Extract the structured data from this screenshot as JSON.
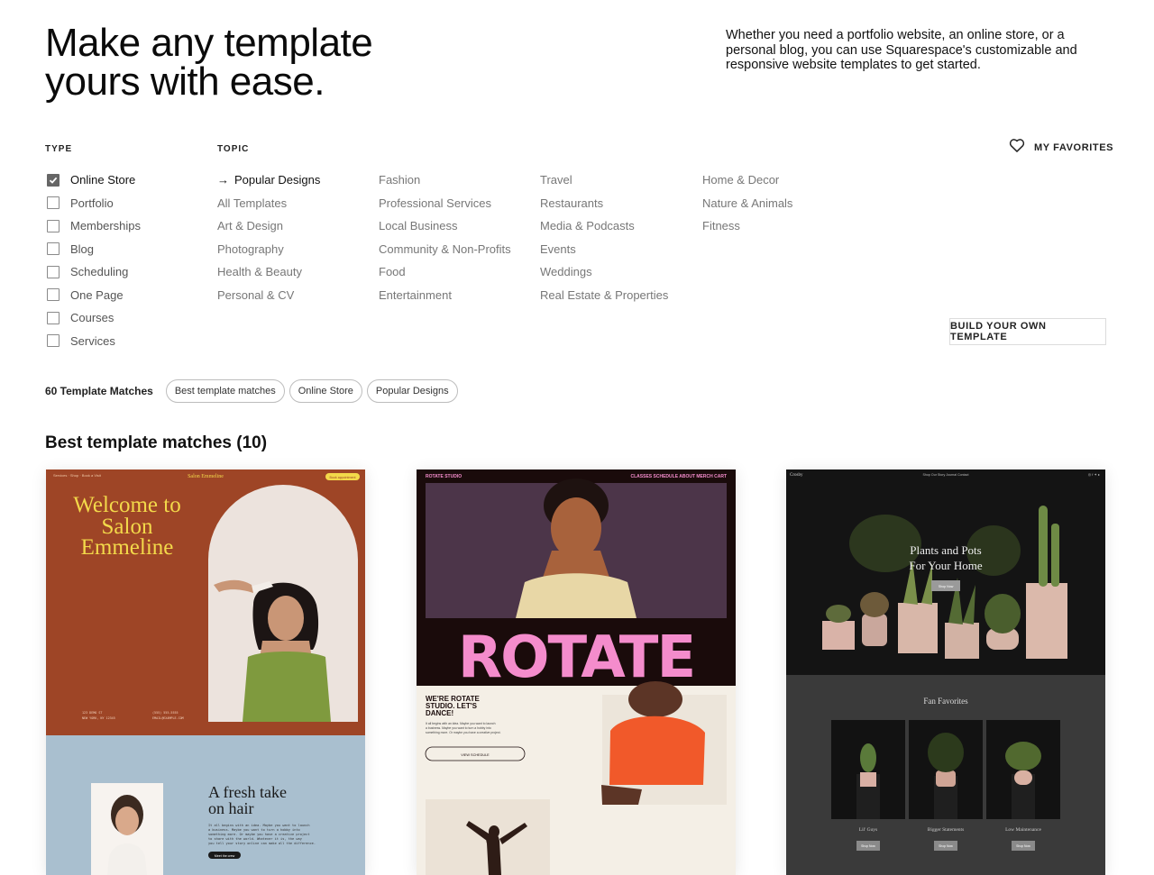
{
  "hero": {
    "title": "Make any template yours with ease.",
    "intro": "Whether you need a portfolio website, an online store, or a personal blog, you can use Squarespace's customizable and responsive website templates to get started."
  },
  "filters": {
    "type_label": "TYPE",
    "topic_label": "TOPIC",
    "types": [
      {
        "label": "Online Store",
        "checked": true
      },
      {
        "label": "Portfolio",
        "checked": false
      },
      {
        "label": "Memberships",
        "checked": false
      },
      {
        "label": "Blog",
        "checked": false
      },
      {
        "label": "Scheduling",
        "checked": false
      },
      {
        "label": "One Page",
        "checked": false
      },
      {
        "label": "Courses",
        "checked": false
      },
      {
        "label": "Services",
        "checked": false
      }
    ],
    "topic_columns": [
      [
        "Popular Designs",
        "All Templates",
        "Art & Design",
        "Photography",
        "Health & Beauty",
        "Personal & CV"
      ],
      [
        "Fashion",
        "Professional Services",
        "Local Business",
        "Community & Non-Profits",
        "Food",
        "Entertainment"
      ],
      [
        "Travel",
        "Restaurants",
        "Media & Podcasts",
        "Events",
        "Weddings",
        "Real Estate & Properties"
      ],
      [
        "Home & Decor",
        "Nature & Animals",
        "Fitness"
      ]
    ],
    "active_topic": "Popular Designs"
  },
  "favorites_label": "MY FAVORITES",
  "build_button": "BUILD YOUR OWN TEMPLATE",
  "results": {
    "count_label": "60 Template Matches",
    "chips": [
      "Best template matches",
      "Online Store",
      "Popular Designs"
    ],
    "section_heading": "Best template matches (10)"
  },
  "templates": [
    {
      "name": "Salon Emmeline",
      "headline": "Welcome to Salon Emmeline",
      "subheadline": "A fresh take on hair",
      "button": "Book appointment",
      "nav_left": "Services · Shop · Book a Visit",
      "footer_cta": "Meet the crew",
      "colors": {
        "top": "#9e4526",
        "bottom": "#a9bfcf",
        "headline": "#f3d94a"
      }
    },
    {
      "name": "ROTATE STUDIO",
      "nav": "CLASSES  SCHEDULE  ABOUT  MERCH  CART",
      "headline": "ROTATE",
      "subheadline": "WE'RE ROTATE STUDIO. LET'S DANCE!",
      "button": "VIEW SCHEDULE",
      "colors": {
        "banner": "#1a0b0b",
        "headline": "#f48ccc",
        "bg": "#f4efe6"
      }
    },
    {
      "name": "Crosby",
      "nav": "Shop  Our Story  Journal  Contact",
      "headline": "Plants and Pots For Your Home",
      "button": "Shop Now",
      "section_title": "Fan Favorites",
      "products": [
        "Lil' Guys",
        "Bigger Statements",
        "Low Maintenance"
      ],
      "product_button": "Shop Now",
      "colors": {
        "top": "#141414",
        "bottom": "#3a3a3a"
      }
    }
  ]
}
